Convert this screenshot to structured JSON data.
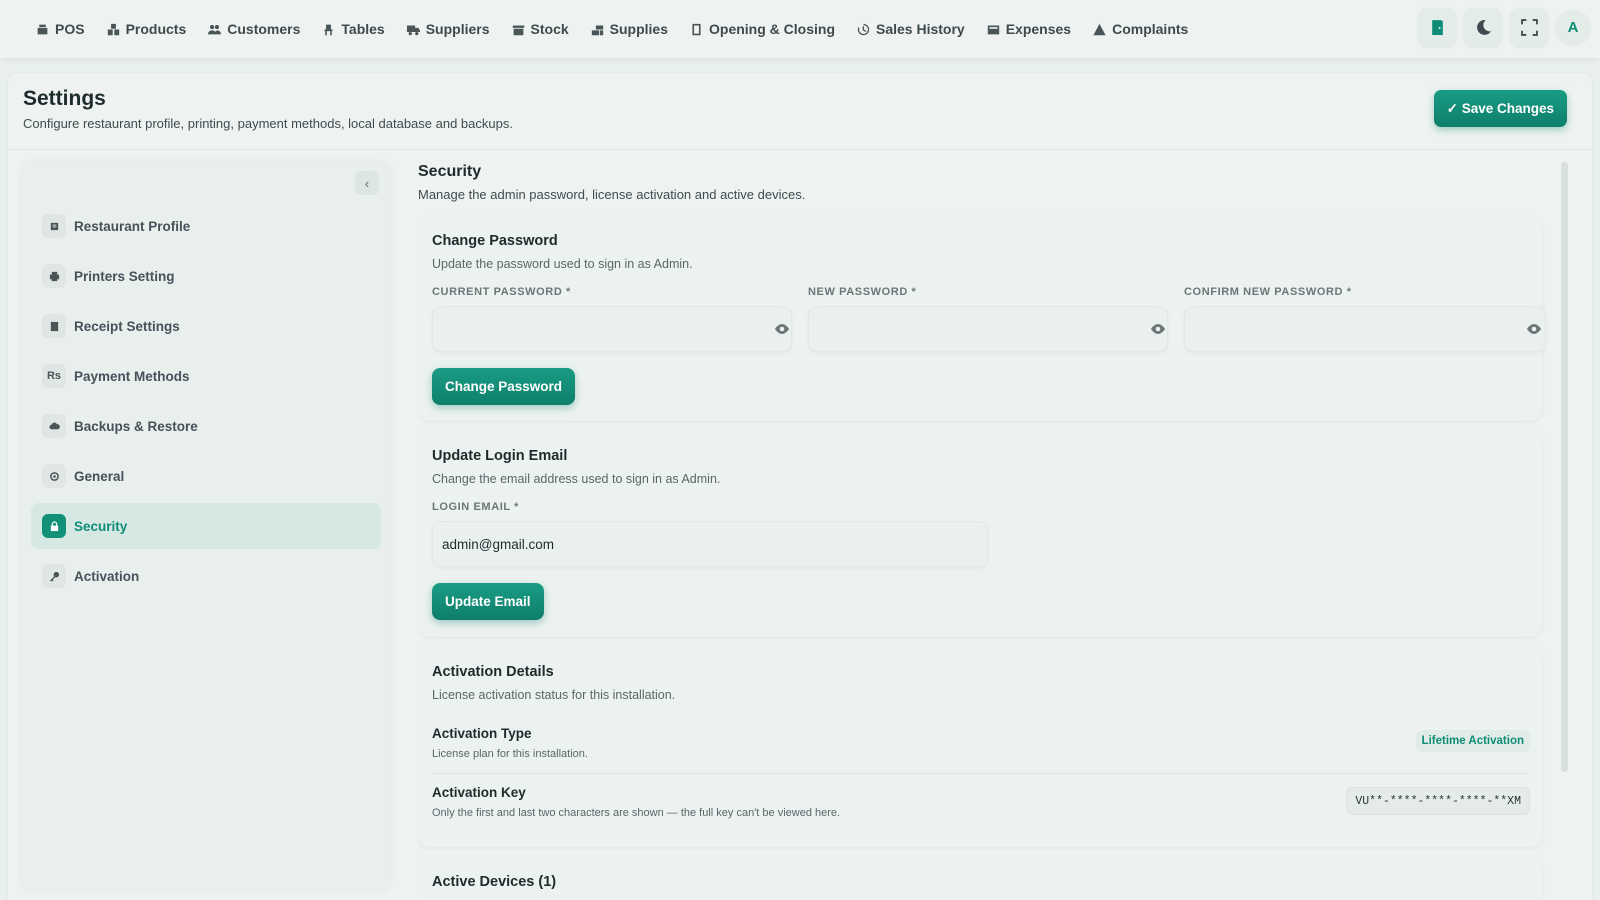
{
  "nav": {
    "items": [
      {
        "label": "POS",
        "icon": "pos-icon"
      },
      {
        "label": "Products",
        "icon": "products-icon"
      },
      {
        "label": "Customers",
        "icon": "customers-icon"
      },
      {
        "label": "Tables",
        "icon": "tables-icon"
      },
      {
        "label": "Suppliers",
        "icon": "suppliers-icon"
      },
      {
        "label": "Stock",
        "icon": "stock-icon"
      },
      {
        "label": "Supplies",
        "icon": "supplies-icon"
      },
      {
        "label": "Opening & Closing",
        "icon": "opening-closing-icon"
      },
      {
        "label": "Sales History",
        "icon": "history-icon"
      },
      {
        "label": "Expenses",
        "icon": "expenses-icon"
      },
      {
        "label": "Complaints",
        "icon": "complaints-icon"
      }
    ],
    "avatar_initial": "A"
  },
  "header": {
    "title": "Settings",
    "subtitle": "Configure restaurant profile, printing, payment methods, local database and backups.",
    "save_label": "✓ Save Changes"
  },
  "sidebar": {
    "collapse_glyph": "‹",
    "items": [
      {
        "label": "Restaurant Profile",
        "icon": "restaurant-icon",
        "glyph": ""
      },
      {
        "label": "Printers Setting",
        "icon": "printer-icon",
        "glyph": ""
      },
      {
        "label": "Receipt Settings",
        "icon": "receipt-icon",
        "glyph": ""
      },
      {
        "label": "Payment Methods",
        "icon": "rupee-icon",
        "glyph": "Rs"
      },
      {
        "label": "Backups & Restore",
        "icon": "cloud-icon",
        "glyph": ""
      },
      {
        "label": "General",
        "icon": "gear-icon",
        "glyph": ""
      },
      {
        "label": "Security",
        "icon": "lock-icon",
        "glyph": "",
        "active": true
      },
      {
        "label": "Activation",
        "icon": "key-icon",
        "glyph": ""
      }
    ]
  },
  "security": {
    "title": "Security",
    "subtitle": "Manage the admin password, license activation and active devices.",
    "change_password": {
      "title": "Change Password",
      "subtitle": "Update the password used to sign in as Admin.",
      "current_label": "CURRENT PASSWORD *",
      "new_label": "NEW PASSWORD *",
      "confirm_label": "CONFIRM NEW PASSWORD *",
      "current_value": "",
      "new_value": "",
      "confirm_value": "",
      "button_label": "Change Password"
    },
    "login_email": {
      "title": "Update Login Email",
      "subtitle": "Change the email address used to sign in as Admin.",
      "label": "LOGIN EMAIL *",
      "value": "admin@gmail.com",
      "button_label": "Update Email"
    },
    "activation": {
      "title": "Activation Details",
      "subtitle": "License activation status for this installation.",
      "type_title": "Activation Type",
      "type_sub": "License plan for this installation.",
      "type_badge": "Lifetime Activation",
      "key_title": "Activation Key",
      "key_sub": "Only the first and last two characters are shown — the full key can't be viewed here.",
      "key_value": "VU**-****-****-****-**XM"
    },
    "devices": {
      "title": "Active Devices (1)"
    }
  },
  "colors": {
    "accent": "#0f8c76",
    "background": "#e9f0ee"
  }
}
